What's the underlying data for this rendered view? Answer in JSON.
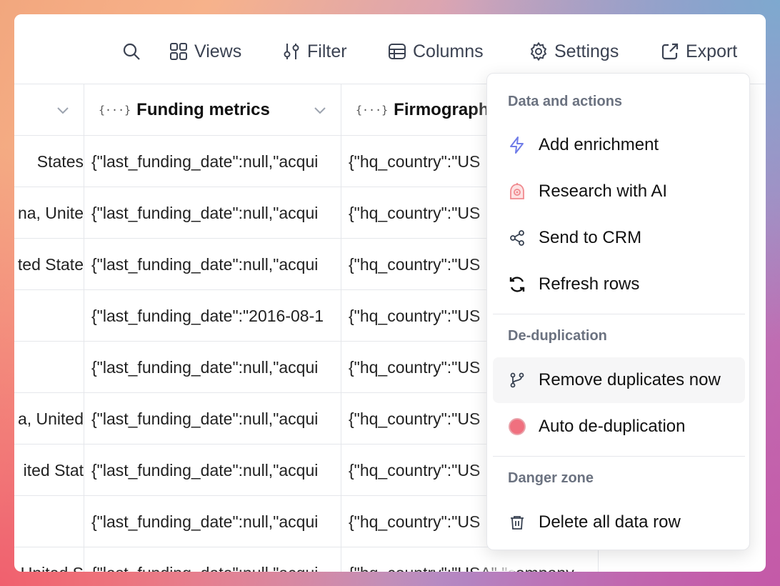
{
  "toolbar": {
    "views_label": "Views",
    "filter_label": "Filter",
    "columns_label": "Columns",
    "settings_label": "Settings",
    "export_label": "Export"
  },
  "table": {
    "headers": [
      "",
      "Funding metrics",
      "Firmographic"
    ],
    "rows": [
      [
        "States",
        "{\"last_funding_date\":null,\"acqui",
        "{\"hq_country\":\"US"
      ],
      [
        "na, Unite",
        "{\"last_funding_date\":null,\"acqui",
        "{\"hq_country\":\"US"
      ],
      [
        "ted State",
        "{\"last_funding_date\":null,\"acqui",
        "{\"hq_country\":\"US"
      ],
      [
        "",
        "{\"last_funding_date\":\"2016-08-1",
        "{\"hq_country\":\"US"
      ],
      [
        "",
        "{\"last_funding_date\":null,\"acqui",
        "{\"hq_country\":\"US"
      ],
      [
        "a, United",
        "{\"last_funding_date\":null,\"acqui",
        "{\"hq_country\":\"US"
      ],
      [
        "ited Stat",
        "{\"last_funding_date\":null,\"acqui",
        "{\"hq_country\":\"US"
      ],
      [
        "",
        "{\"last_funding_date\":null,\"acqui",
        "{\"hq_country\":\"US"
      ],
      [
        "United S",
        "{\"last_funding_date\":null,\"acqui",
        "{\"hq_country\":\"USA\",\"company"
      ]
    ]
  },
  "menu": {
    "sections": [
      {
        "title": "Data and actions",
        "items": [
          {
            "label": "Add enrichment",
            "icon": "lightning-icon"
          },
          {
            "label": "Research with AI",
            "icon": "ai-robot-icon"
          },
          {
            "label": "Send to CRM",
            "icon": "share-nodes-icon"
          },
          {
            "label": "Refresh rows",
            "icon": "refresh-icon"
          }
        ]
      },
      {
        "title": "De-duplication",
        "items": [
          {
            "label": "Remove duplicates now",
            "icon": "git-branch-icon"
          },
          {
            "label": "Auto de-duplication",
            "icon": "toggle-dot-icon"
          }
        ]
      },
      {
        "title": "Danger zone",
        "items": [
          {
            "label": "Delete all data row",
            "icon": "trash-icon"
          }
        ]
      }
    ]
  },
  "colors": {
    "accent_lightning": "#6f7ce8",
    "ai_icon": "#f08a8f",
    "toggle_dot": "#f0707f",
    "text_muted": "#6b7280"
  }
}
